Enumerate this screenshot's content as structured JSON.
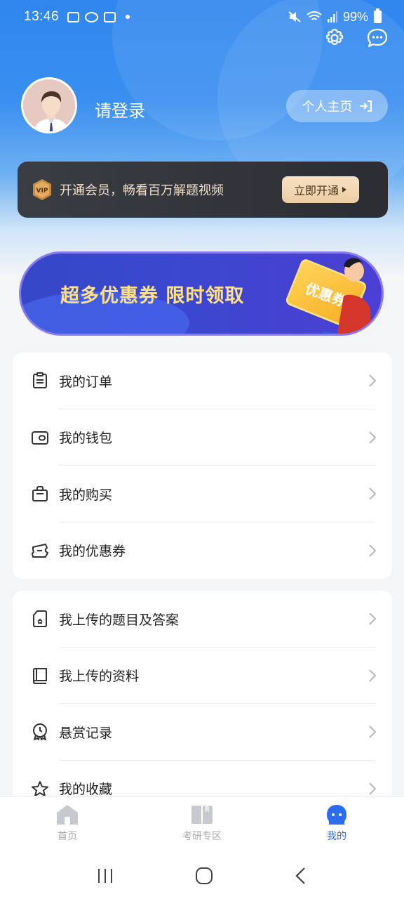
{
  "status_bar": {
    "time": "13:46",
    "battery": "99%"
  },
  "profile": {
    "login_text": "请登录",
    "homepage_label": "个人主页"
  },
  "vip": {
    "text": "开通会员，畅看百万解题视频",
    "button": "立即开通",
    "badge": "VIP"
  },
  "coupon_banner": {
    "text": "超多优惠券 限时领取",
    "card_label": "优惠券"
  },
  "menu_group_1": [
    {
      "label": "我的订单",
      "icon": "order-list-icon"
    },
    {
      "label": "我的钱包",
      "icon": "wallet-icon"
    },
    {
      "label": "我的购买",
      "icon": "shopping-bag-icon"
    },
    {
      "label": "我的优惠券",
      "icon": "coupon-icon"
    }
  ],
  "menu_group_2": [
    {
      "label": "我上传的题目及答案",
      "icon": "upload-doc-icon"
    },
    {
      "label": "我上传的资料",
      "icon": "book-icon"
    },
    {
      "label": "悬赏记录",
      "icon": "reward-clock-icon"
    },
    {
      "label": "我的收藏",
      "icon": "star-icon"
    }
  ],
  "bottom_nav": [
    {
      "label": "首页",
      "icon": "home-icon"
    },
    {
      "label": "考研专区",
      "icon": "book-open-icon"
    },
    {
      "label": "我的",
      "icon": "user-face-icon"
    }
  ],
  "active_tab": "我的",
  "colors": {
    "accent": "#2b6cf0",
    "hero": "#2f86ee",
    "vip_gold": "#eccda2"
  }
}
